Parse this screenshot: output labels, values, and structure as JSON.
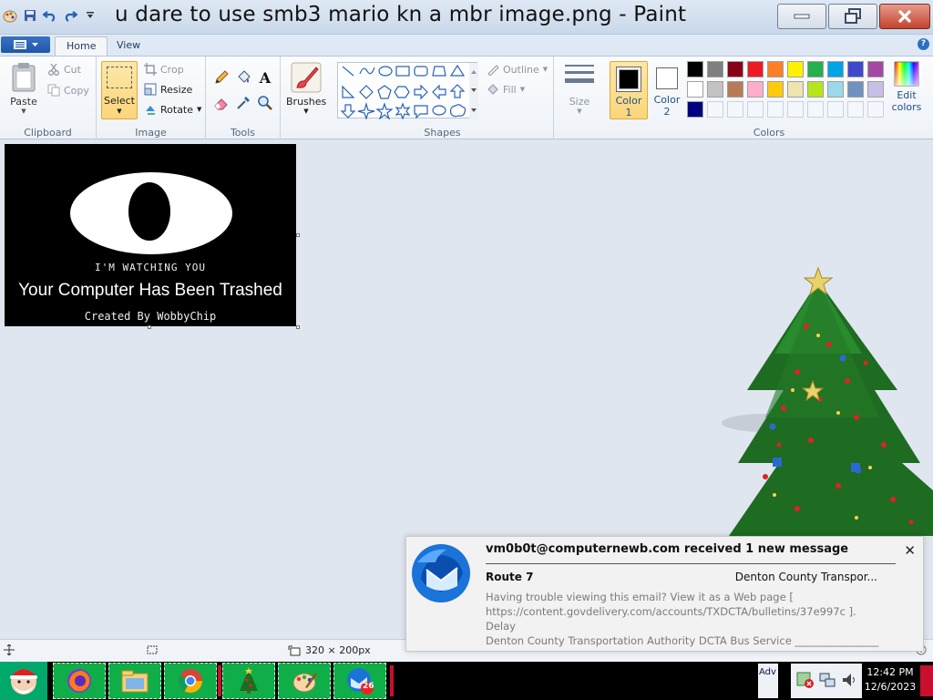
{
  "window": {
    "title": "u dare to use smb3 mario kn a mbr image.png - Paint"
  },
  "ribbon_tabs": {
    "home": "Home",
    "view": "View"
  },
  "ribbon": {
    "clipboard": {
      "group_label": "Clipboard",
      "paste": "Paste",
      "cut": "Cut",
      "copy": "Copy"
    },
    "image": {
      "group_label": "Image",
      "select": "Select",
      "crop": "Crop",
      "resize": "Resize",
      "rotate": "Rotate"
    },
    "tools": {
      "group_label": "Tools"
    },
    "brushes": {
      "label": "Brushes"
    },
    "shapes": {
      "group_label": "Shapes",
      "outline": "Outline",
      "fill": "Fill"
    },
    "size": {
      "label": "Size"
    },
    "colors": {
      "group_label": "Colors",
      "color1": "Color",
      "color1_num": "1",
      "color2": "Color",
      "color2_num": "2",
      "color1_value": "#000000",
      "color2_value": "#ffffff",
      "edit_colors_1": "Edit",
      "edit_colors_2": "colors",
      "palette_row1": [
        "#000000",
        "#7f7f7f",
        "#880015",
        "#ed1c24",
        "#ff7f27",
        "#fff200",
        "#22b14c",
        "#00a2e8",
        "#3f48cc",
        "#a349a4"
      ],
      "palette_row2": [
        "#ffffff",
        "#c3c3c3",
        "#b97a57",
        "#ffaec9",
        "#ffc90e",
        "#efe4b0",
        "#b5e61d",
        "#99d9ea",
        "#7092be",
        "#c8bfe7"
      ],
      "palette_row3": [
        "#000080"
      ]
    }
  },
  "canvas_image": {
    "line1": "I'M WATCHING YOU",
    "line2": "Your Computer Has Been Trashed",
    "line3": "Created By WobbyChip"
  },
  "statusbar": {
    "image_size": "320 × 200px"
  },
  "notification": {
    "from": "vm0b0t@computernewb.com received 1 new message",
    "subject": "Route 7",
    "sender": "Denton County Transpor...",
    "body_line1": "Having trouble viewing this email? View it as a Web page [",
    "body_line2": "https://content.govdelivery.com/accounts/TXDCTA/bulletins/37e997c ].  Delay",
    "body_line3": "Denton County Transportation Authority DCTA Bus Service ________________"
  },
  "taskbar": {
    "thunderbird_badge": "26",
    "tray_text": "Adv",
    "time": "12:42 PM",
    "date": "12/6/2023"
  }
}
